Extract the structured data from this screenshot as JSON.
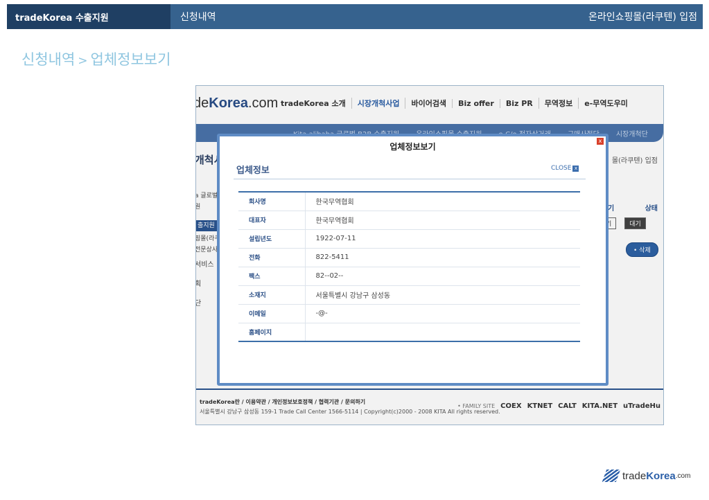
{
  "topbar": {
    "brand": "tradeKorea 수출지원",
    "section": "신청내역",
    "right": "온라인쇼핑몰(라쿠텐) 입점"
  },
  "breadcrumb": {
    "part1": "신청내역",
    "sep": ">",
    "part2": "업체정보보기"
  },
  "site": {
    "logo_prefix": "de",
    "logo_brand": "Korea",
    ".com": ".com",
    "logo_suffix": ".com",
    "menu": [
      "tradeKorea 소개",
      "시장개척사업",
      "바이어검색",
      "Biz offer",
      "Biz PR",
      "무역정보",
      "e-무역도우미"
    ],
    "nav": [
      "Kita.alibaba 글로벌 B2B 수출지원",
      "온라인쇼핑몰 수출지원",
      "e-C/o 전자상거래",
      "구매사절단",
      "시장개척단"
    ],
    "left_title": "개척시",
    "left_menu": [
      "a 글로벌",
      "원",
      "출지원",
      "핑몰(라쿠",
      "전문상사",
      "서비스",
      "획",
      "단"
    ],
    "right_text": "몰(라쿠텐) 입점",
    "col1": "기",
    "col2": "상태",
    "btn1": "기",
    "btn2": "대기",
    "delete": "• 삭제",
    "footer_links": "tradeKorea란 / 이용약관 / 개인정보보호정책 / 협력기관 / 문의하기",
    "footer_addr": "서울특별시 강남구 삼성동 159-1 Trade Call Center 1566-5114 | Copyright(c)2000 - 2008 KITA All rights reserved.",
    "family_label": "• FAMILY SITE",
    "family": [
      "COEX",
      "KTNET",
      "CALT",
      "KITA.NET",
      "uTradeHu"
    ]
  },
  "modal": {
    "title": "업체정보보기",
    "close_icon": "x",
    "heading": "업체정보",
    "close_label": "CLOSE",
    "rows": [
      {
        "k": "회사명",
        "v": "한국무역협회"
      },
      {
        "k": "대표자",
        "v": "한국무역협회"
      },
      {
        "k": "설립년도",
        "v": "1922-07-11"
      },
      {
        "k": "전화",
        "v": "822-5411"
      },
      {
        "k": "팩스",
        "v": "82--02--"
      },
      {
        "k": "소재지",
        "v": "서울특별시 강남구 삼성동"
      },
      {
        "k": "이메일",
        "v": "-@-"
      },
      {
        "k": "홈페이지",
        "v": ""
      }
    ]
  },
  "footer_logo": {
    "brand1": "trade",
    "brand2": "Korea",
    "suffix": ".com"
  }
}
